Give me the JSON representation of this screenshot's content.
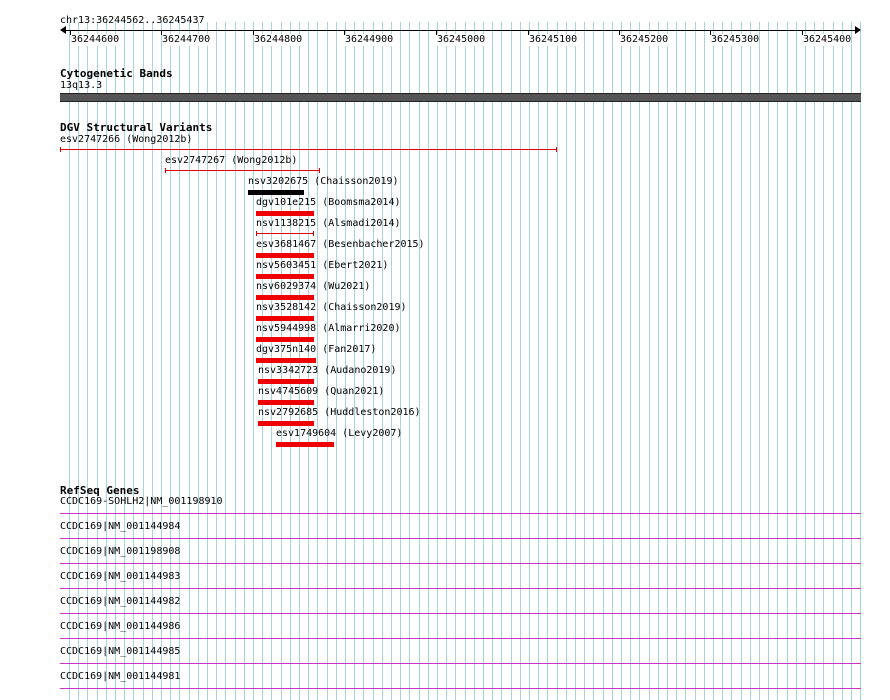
{
  "view": {
    "location": "chr13:36244562..36245437",
    "ticks": [
      "36244600",
      "36244700",
      "36244800",
      "36244900",
      "36245000",
      "36245100",
      "36245200",
      "36245300",
      "36245400"
    ]
  },
  "cytobands": {
    "title": "Cytogenetic Bands",
    "band_label": "13q13.3"
  },
  "dgv": {
    "title": "DGV Structural Variants",
    "variants": [
      {
        "label": "esv2747266 (Wong2012b)",
        "style": "line",
        "color": "#dd0000"
      },
      {
        "label": "esv2747267 (Wong2012b)",
        "style": "line",
        "color": "#dd0000"
      },
      {
        "label": "nsv3202675 (Chaisson2019)",
        "style": "bar",
        "color": "#000000"
      },
      {
        "label": "dgv101e215 (Boomsma2014)",
        "style": "bar",
        "color": "#ee0000"
      },
      {
        "label": "nsv1138215 (Alsmadi2014)",
        "style": "line",
        "color": "#dd0000"
      },
      {
        "label": "esv3681467 (Besenbacher2015)",
        "style": "bar",
        "color": "#ee0000"
      },
      {
        "label": "nsv5603451 (Ebert2021)",
        "style": "bar",
        "color": "#ee0000"
      },
      {
        "label": "nsv6029374 (Wu2021)",
        "style": "bar",
        "color": "#ee0000"
      },
      {
        "label": "nsv3528142 (Chaisson2019)",
        "style": "bar",
        "color": "#ee0000"
      },
      {
        "label": "nsv5944998 (Almarri2020)",
        "style": "bar",
        "color": "#ee0000"
      },
      {
        "label": "dgv375n140 (Fan2017)",
        "style": "bar",
        "color": "#ee0000"
      },
      {
        "label": "nsv3342723 (Audano2019)",
        "style": "bar",
        "color": "#ee0000"
      },
      {
        "label": "nsv4745609 (Quan2021)",
        "style": "bar",
        "color": "#ee0000"
      },
      {
        "label": "nsv2792685 (Huddleston2016)",
        "style": "bar",
        "color": "#ee0000"
      },
      {
        "label": "esv1749604 (Levy2007)",
        "style": "bar",
        "color": "#ee0000"
      }
    ]
  },
  "refseq": {
    "title": "RefSeq Genes",
    "genes": [
      "CCDC169-SOHLH2|NM_001198910",
      "CCDC169|NM_001144984",
      "CCDC169|NM_001198908",
      "CCDC169|NM_001144983",
      "CCDC169|NM_001144982",
      "CCDC169|NM_001144986",
      "CCDC169|NM_001144985",
      "CCDC169|NM_001144981"
    ],
    "color": "#cc33cc"
  },
  "colors": {
    "grid": "#a9d3de",
    "band": "#555555"
  }
}
